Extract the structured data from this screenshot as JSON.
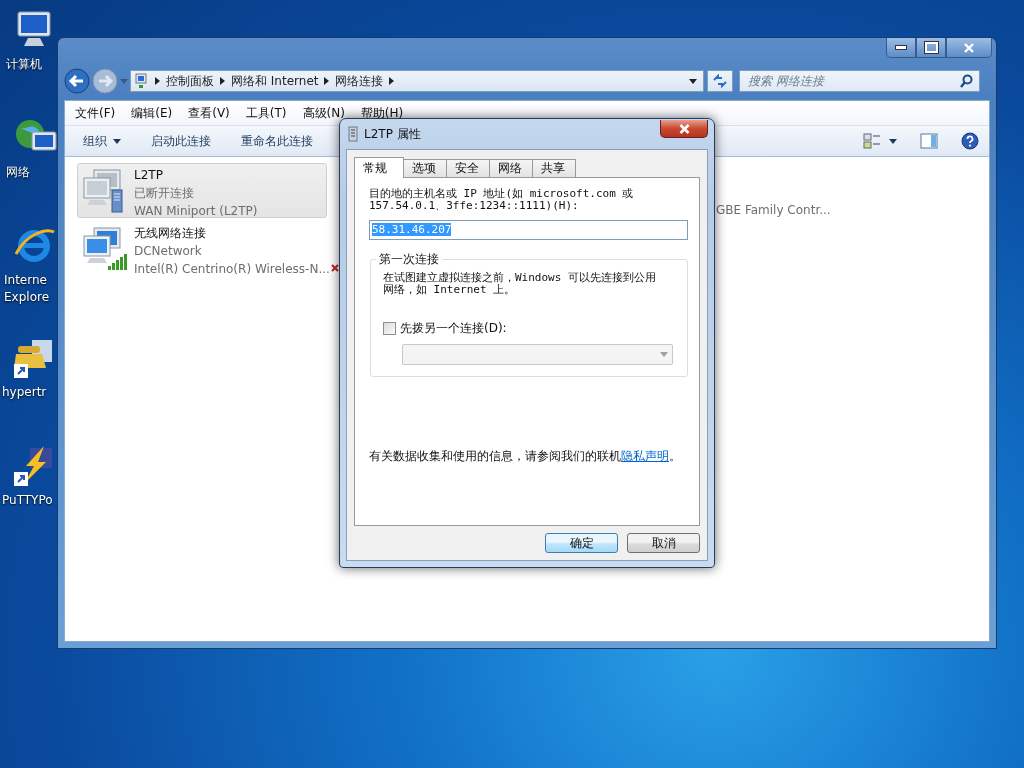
{
  "desktop_icons": [
    {
      "kind": "computer",
      "lines": [
        "计算机"
      ]
    },
    {
      "kind": "network",
      "lines": [
        "网络"
      ]
    },
    {
      "kind": "browser",
      "lines": [
        "Interne",
        "Explore"
      ]
    },
    {
      "kind": "phone",
      "lines": [
        "hypertr"
      ]
    },
    {
      "kind": "lightning",
      "lines": [
        "PuTTYPo"
      ]
    }
  ],
  "explorer": {
    "address_path": [
      "控制面板",
      "网络和 Internet",
      "网络连接"
    ],
    "search": {
      "placeholder": "搜索 网络连接"
    },
    "menu": [
      "文件(F)",
      "编辑(E)",
      "查看(V)",
      "工具(T)",
      "高级(N)",
      "帮助(H)"
    ],
    "toolbar": [
      {
        "label": "组织",
        "dropdown": true
      },
      {
        "label": "启动此连接",
        "dropdown": false
      },
      {
        "label": "重命名此连接",
        "dropdown": false
      }
    ],
    "connections": [
      {
        "kind": "vpn",
        "name": "L2TP",
        "status": "已断开连接",
        "device": "WAN Miniport (L2TP)",
        "selected": true
      },
      {
        "kind": "wireless",
        "name": "无线网络连接",
        "status": "DCNetwork",
        "device": "Intel(R) Centrino(R) Wireless-N...",
        "selected": false
      }
    ],
    "partial_device": "GBE Family Contr..."
  },
  "dialog": {
    "title": "L2TP 属性",
    "tabs": [
      {
        "label": "常规",
        "selected": true
      },
      {
        "label": "选项",
        "selected": false
      },
      {
        "label": "安全",
        "selected": false
      },
      {
        "label": "网络",
        "selected": false
      },
      {
        "label": "共享",
        "selected": false
      }
    ],
    "host_label": "目的地的主机名或 IP 地址(如 microsoft.com 或 157.54.0.1、3ffe:1234::1111)(H):",
    "host_value": "58.31.46.207",
    "host_value_selected": true,
    "group": {
      "title": "第一次连接",
      "description": "在试图建立虚拟连接之前，Windows 可以先连接到公用网络，如 Internet 上。",
      "dial_first": {
        "label": "先拨另一个连接(D):",
        "checked": false
      },
      "dropdown": {
        "disabled": true
      }
    },
    "privacy": {
      "text": "有关数据收集和使用的信息，请参阅我们的联机",
      "link": "隐私声明",
      "end": "。"
    },
    "buttons": [
      {
        "label": "确定",
        "default": true
      },
      {
        "label": "取消",
        "default": false
      }
    ]
  }
}
